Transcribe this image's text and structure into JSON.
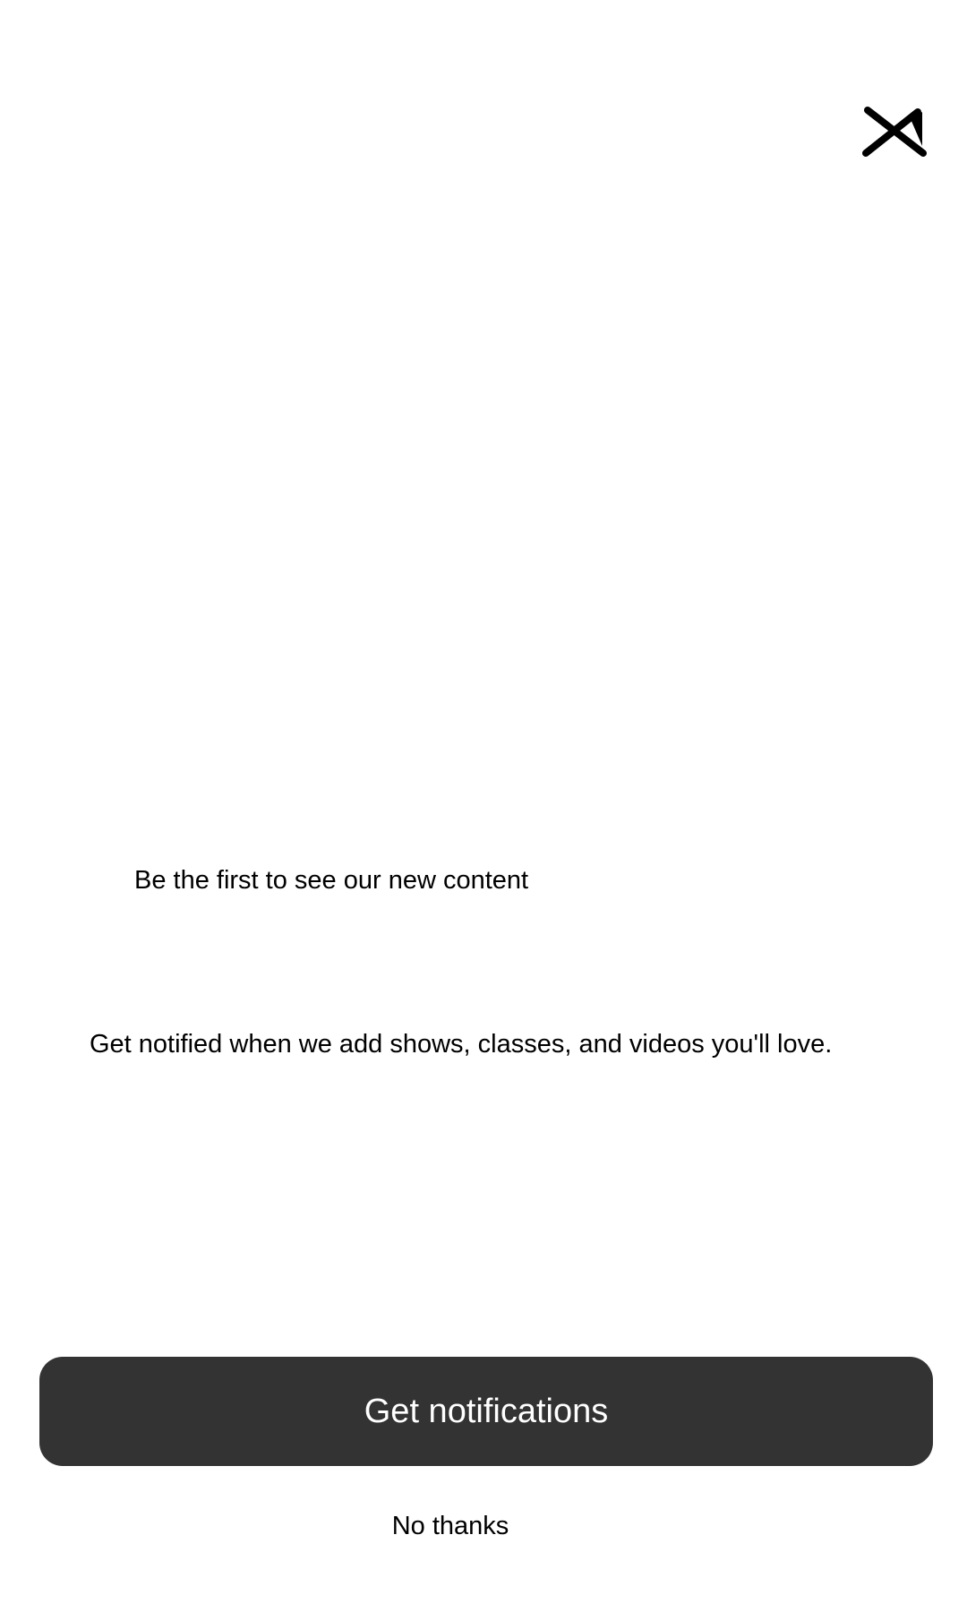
{
  "dialog": {
    "close_icon": "close-icon",
    "headline": "Be the first to see our new content",
    "subtext": "Get notified when we add shows, classes, and videos you'll love.",
    "primary_button": "Get notifications",
    "secondary_button": "No thanks"
  },
  "colors": {
    "background": "#ffffff",
    "primary_button_bg": "#333333",
    "primary_button_text": "#ffffff",
    "text": "#000000"
  }
}
